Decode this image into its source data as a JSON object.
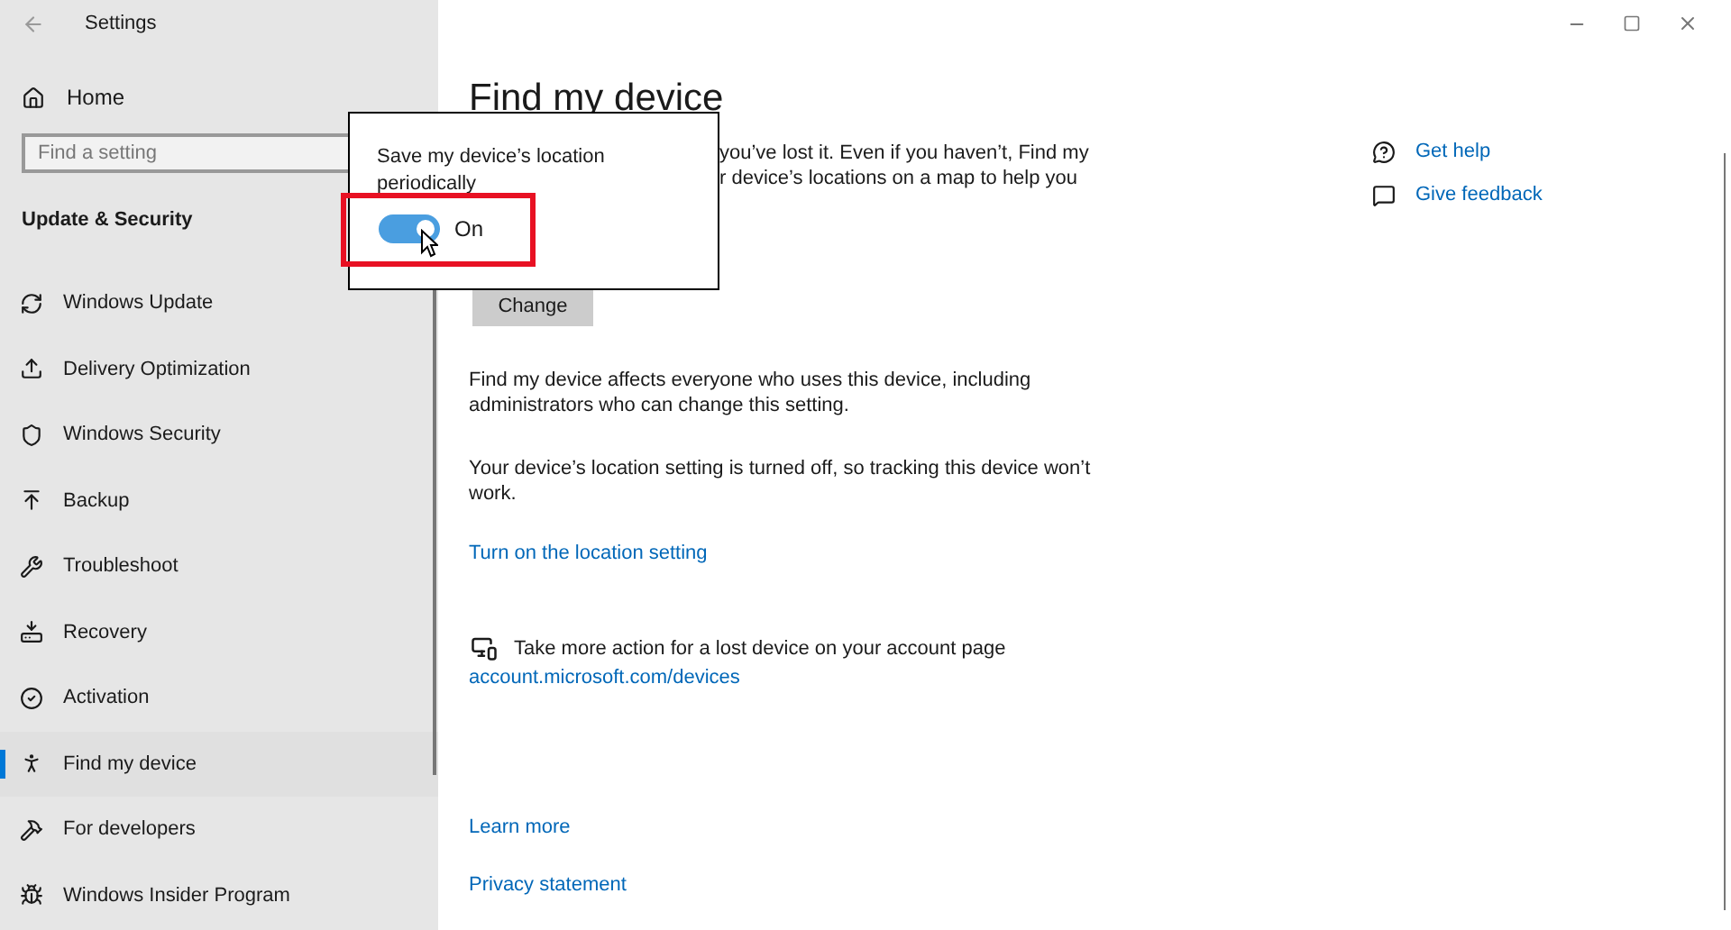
{
  "window": {
    "title": "Settings"
  },
  "sidebar": {
    "home": "Home",
    "search": {
      "placeholder": "Find a setting"
    },
    "section": "Update & Security",
    "items": [
      {
        "label": "Windows Update",
        "selected": false
      },
      {
        "label": "Delivery Optimization",
        "selected": false
      },
      {
        "label": "Windows Security",
        "selected": false
      },
      {
        "label": "Backup",
        "selected": false
      },
      {
        "label": "Troubleshoot",
        "selected": false
      },
      {
        "label": "Recovery",
        "selected": false
      },
      {
        "label": "Activation",
        "selected": false
      },
      {
        "label": "Find my device",
        "selected": true
      },
      {
        "label": "For developers",
        "selected": false
      },
      {
        "label": "Windows Insider Program",
        "selected": false
      }
    ]
  },
  "main": {
    "title": "Find my device",
    "description_visible_lines": [
      "you’ve lost it. Even if you haven’t, Find my",
      "r device’s locations on a map to help you"
    ],
    "change_button": "Change",
    "notes": [
      "Find my device affects everyone who uses this device, including administrators who can change this setting.",
      "Your device’s location setting is turned off, so tracking this device won’t work."
    ],
    "location_link": "Turn on the location setting",
    "account_text": "Take more action for a lost device on your account page",
    "account_link": "account.microsoft.com/devices",
    "footer_links": [
      "Learn more",
      "Privacy statement"
    ]
  },
  "related": [
    "Get help",
    "Give feedback"
  ],
  "popup": {
    "label": "Save my device’s location periodically",
    "toggle": {
      "on": true,
      "state_text": "On"
    },
    "highlighted": true
  }
}
